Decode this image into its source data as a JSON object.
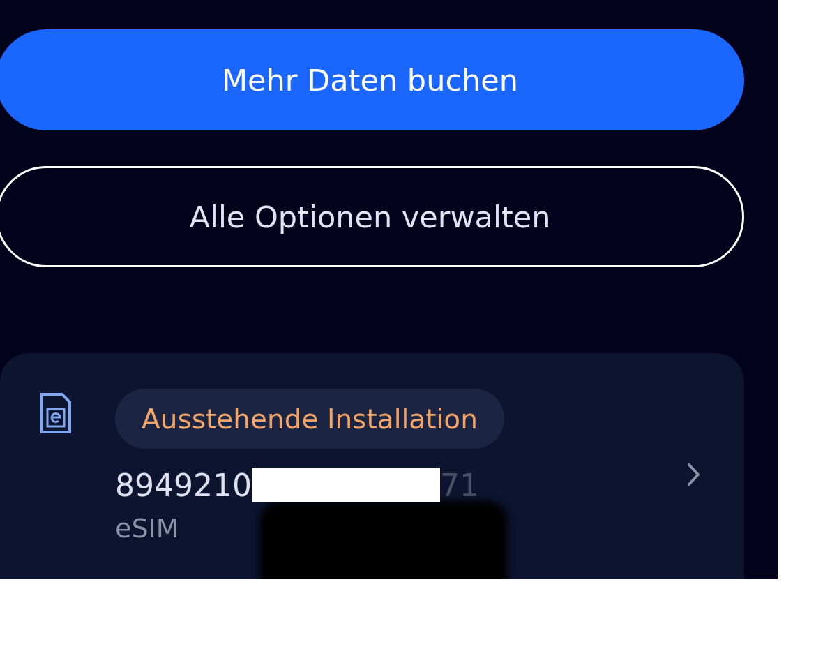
{
  "buttons": [
    {
      "label": "Mehr Daten buchen",
      "kind": "primary"
    },
    {
      "label": "Alle Optionen verwalten",
      "kind": "outline"
    }
  ],
  "sim_card": {
    "status": "Ausstehende Installation",
    "number_start": "8949210",
    "number_end": "71",
    "type": "eSIM"
  }
}
